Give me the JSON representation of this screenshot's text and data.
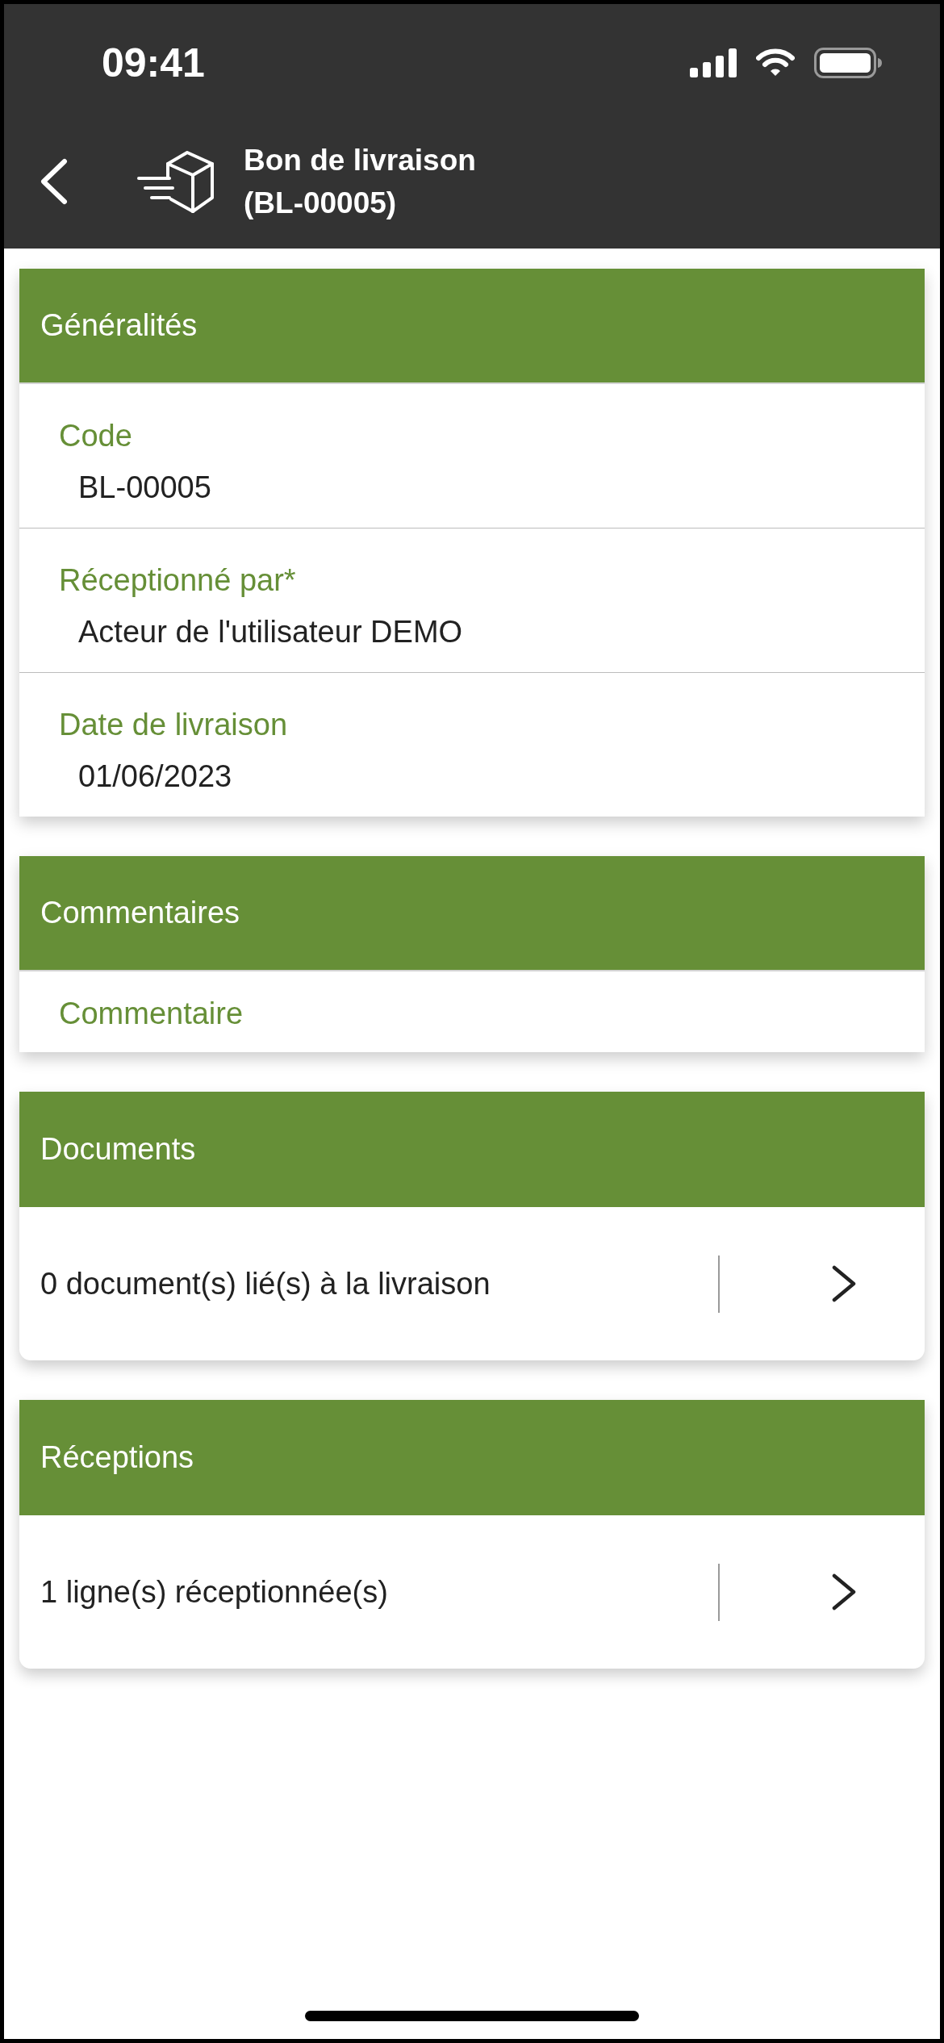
{
  "status_bar": {
    "time": "09:41"
  },
  "header": {
    "title": "Bon de livraison",
    "subtitle": "(BL-00005)"
  },
  "sections": [
    {
      "title": "Généralités",
      "kind": "fields",
      "fields": [
        {
          "label": "Code",
          "value": "BL-00005"
        },
        {
          "label": "Réceptionné par*",
          "value": "Acteur de l'utilisateur DEMO"
        },
        {
          "label": "Date de livraison",
          "value": "01/06/2023"
        }
      ]
    },
    {
      "title": "Commentaires",
      "kind": "fields",
      "fields": [
        {
          "label": "Commentaire"
        }
      ]
    },
    {
      "title": "Documents",
      "kind": "link",
      "text": "0 document(s) lié(s) à la livraison"
    },
    {
      "title": "Réceptions",
      "kind": "link",
      "text": "1 ligne(s) réceptionnée(s)"
    }
  ]
}
